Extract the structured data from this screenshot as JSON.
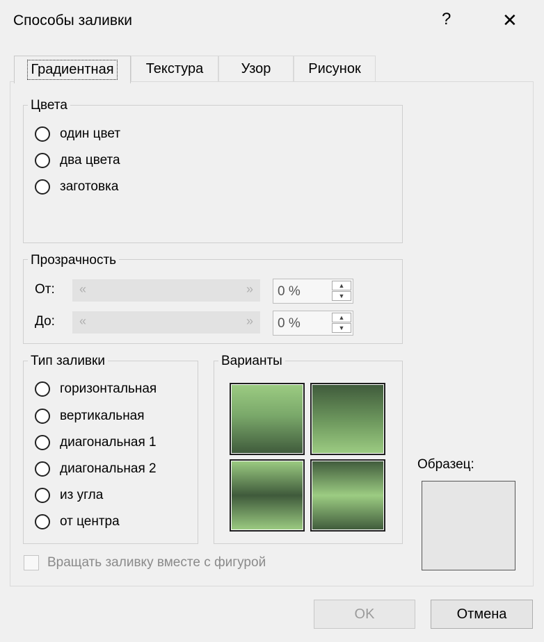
{
  "dialog": {
    "title": "Способы заливки",
    "help": "?",
    "close": "✕"
  },
  "tabs": [
    {
      "label": "Градиентная",
      "active": true
    },
    {
      "label": "Текстура"
    },
    {
      "label": "Узор"
    },
    {
      "label": "Рисунок"
    }
  ],
  "colors_group": {
    "legend": "Цвета",
    "options": [
      "один цвет",
      "два цвета",
      "заготовка"
    ]
  },
  "transparency": {
    "legend": "Прозрачность",
    "from_label": "От:",
    "to_label": "До:",
    "from_value": "0 %",
    "to_value": "0 %",
    "left_arrow": "«",
    "right_arrow": "»"
  },
  "fill_type": {
    "legend": "Тип заливки",
    "options": [
      "горизонтальная",
      "вертикальная",
      "диагональная 1",
      "диагональная 2",
      "из угла",
      "от центра"
    ]
  },
  "variants": {
    "legend": "Варианты",
    "light_color": "#9ccc82",
    "dark_color": "#3f5a3b"
  },
  "sample": {
    "label": "Образец:"
  },
  "rotate_checkbox": {
    "label": "Вращать заливку вместе с фигурой",
    "checked": false
  },
  "buttons": {
    "ok": "OK",
    "cancel": "Отмена"
  }
}
